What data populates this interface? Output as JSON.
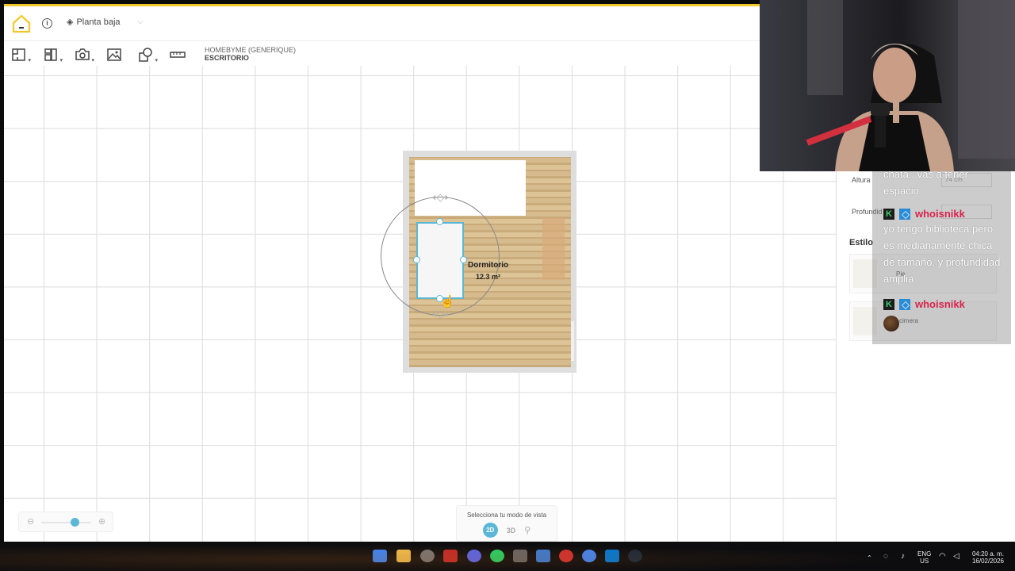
{
  "header": {
    "floor_selector": "Planta baja",
    "project_brand": "HOMEBYME (GENERIQUE)",
    "project_name": "ESCRITORIO"
  },
  "toolbar": {
    "icons": [
      "floorplan-icon",
      "furniture-icon",
      "camera-icon",
      "image-icon",
      "shape-icon",
      "ruler-icon"
    ]
  },
  "room": {
    "name": "Dormitorio",
    "area": "12.3 m²"
  },
  "view_mode": {
    "label": "Selecciona tu modo de vista",
    "mode_2d": "2D",
    "mode_3d": "3D",
    "active": "2D"
  },
  "zoom": {
    "level_fraction": 0.55
  },
  "properties_panel": {
    "altura_label": "Altura",
    "altura_value": "74 cm",
    "profundidad_label": "Profundid",
    "estilo_label": "Estilo",
    "card1_text": "Pie",
    "card2_text": "cimera"
  },
  "chat": {
    "messages": [
      {
        "user": "",
        "text": "chata.. vas a tener espacio"
      },
      {
        "user": "whoisnikk",
        "text": "yo tengo biblioteca pero es medianamente chica de tamaño, y profundidad amplia"
      },
      {
        "user": "whoisnikk",
        "text": ""
      }
    ]
  },
  "system_tray": {
    "lang_line1": "ENG",
    "lang_line2": "US",
    "time": "04:20 a. m.",
    "date": "16/02/2026"
  },
  "colors": {
    "accent": "#5bb7d6",
    "topline": "#f0c929",
    "chat_username": "#d8234c"
  }
}
